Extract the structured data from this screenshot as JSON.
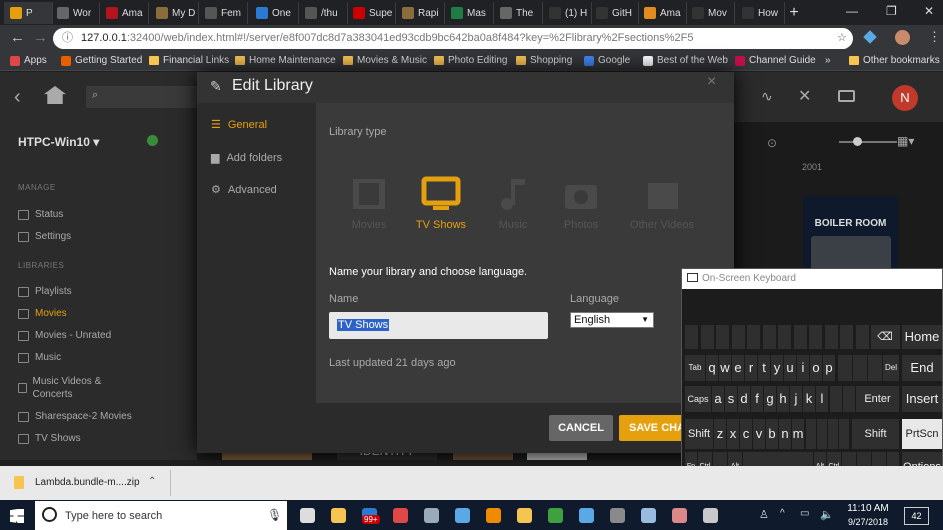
{
  "browser": {
    "tabs": [
      {
        "label": "P",
        "icon": "plex-icon",
        "color": "#e5a00d"
      },
      {
        "label": "Wor",
        "icon": "page-icon",
        "color": "#666"
      },
      {
        "label": "Ama",
        "icon": "adobe-icon",
        "color": "#b3141d"
      },
      {
        "label": "My D",
        "icon": "folder-icon",
        "color": "#8a6d3b"
      },
      {
        "label": "Fem",
        "icon": "wordpress-icon",
        "color": "#555"
      },
      {
        "label": "One",
        "icon": "diamond-icon",
        "color": "#2a7ad3"
      },
      {
        "label": "/thu",
        "icon": "google-icon",
        "color": "#555"
      },
      {
        "label": "Supe",
        "icon": "flag-icon",
        "color": "#c00"
      },
      {
        "label": "Rapi",
        "icon": "folder-icon",
        "color": "#8a6d3b"
      },
      {
        "label": "Mas",
        "icon": "sheet-icon",
        "color": "#1e7d44"
      },
      {
        "label": "The",
        "icon": "page-icon",
        "color": "#666"
      },
      {
        "label": "(1) H",
        "icon": "chevron-icon",
        "color": "#333"
      },
      {
        "label": "GitH",
        "icon": "github-icon",
        "color": "#333"
      },
      {
        "label": "Ama",
        "icon": "amazon-icon",
        "color": "#e48b1e"
      },
      {
        "label": "Mov",
        "icon": "chevron-icon",
        "color": "#333"
      },
      {
        "label": "How",
        "icon": "chevron-icon",
        "color": "#333"
      }
    ],
    "url": "127.0.0.1",
    "url_rest": ":32400/web/index.html#!/server/e8f007dc8d7a383041ed93cdb9bc642ba0a8f484?key=%2Flibrary%2Fsections%2F5",
    "bookmarks": [
      {
        "label": "Apps",
        "icon": "apps-icon"
      },
      {
        "label": "Getting Started",
        "icon": "firefox-icon"
      },
      {
        "label": "Financial Links",
        "icon": "folder-icon"
      },
      {
        "label": "Home Maintenance",
        "icon": "folder-icon"
      },
      {
        "label": "Movies & Music",
        "icon": "folder-icon"
      },
      {
        "label": "Photo Editing",
        "icon": "folder-icon"
      },
      {
        "label": "Shopping",
        "icon": "folder-icon"
      },
      {
        "label": "Google",
        "icon": "google-icon"
      },
      {
        "label": "Best of the Web",
        "icon": "m-icon"
      },
      {
        "label": "Channel Guide",
        "icon": "y-icon"
      }
    ],
    "more_bookmarks": "»",
    "other_bookmarks": "Other bookmarks"
  },
  "plex": {
    "server_name": "HTPC-Win10",
    "year_label": "2001",
    "poster_title": "BOILER ROOM",
    "identity_title": "IDENTITY",
    "user_initial": "N",
    "manage_header": "MANAGE",
    "libraries_header": "LIBRARIES",
    "sidebar_manage": [
      "Status",
      "Settings"
    ],
    "sidebar_libraries": [
      "Playlists",
      "Movies",
      "Movies - Unrated",
      "Music",
      "Music Videos & Concerts",
      "Sharespace-2 Movies",
      "TV Shows"
    ],
    "active_color": "#e5a00d"
  },
  "dialog": {
    "title": "Edit Library",
    "close": "×",
    "nav": [
      "General",
      "Add folders",
      "Advanced"
    ],
    "library_type_label": "Library type",
    "types": [
      "Movies",
      "TV Shows",
      "Music",
      "Photos",
      "Other Videos"
    ],
    "selected_type": "TV Shows",
    "section_title": "Name your library and choose language.",
    "name_label": "Name",
    "name_value": "TV Shows",
    "language_label": "Language",
    "language_value": "English",
    "last_updated": "Last updated 21 days ago",
    "cancel": "CANCEL",
    "save": "SAVE CHA"
  },
  "keyboard": {
    "title": "On-Screen Keyboard",
    "row1_letters": [
      "q",
      "w",
      "e",
      "r",
      "t",
      "y",
      "u",
      "i",
      "o",
      "p"
    ],
    "row2_letters": [
      "a",
      "s",
      "d",
      "f",
      "g",
      "h",
      "j",
      "k",
      "l"
    ],
    "row3_letters": [
      "z",
      "x",
      "c",
      "v",
      "b",
      "n",
      "m"
    ],
    "labels": {
      "tab": "Tab",
      "caps": "Caps",
      "shift": "Shift",
      "shift_right": "Shift",
      "enter": "Enter",
      "fn": "Fn",
      "ctrl": "Ctrl",
      "alt": "Alt",
      "alt_gr": "Alt",
      "ctrl_right": "Ctrl",
      "del": "Del",
      "backspace": "⌫",
      "home": "Home",
      "end": "End",
      "insert": "Insert",
      "prtscn": "PrtScn",
      "options": "Options"
    }
  },
  "downloads": {
    "file": "Lambda.bundle-m....zip"
  },
  "taskbar": {
    "search_placeholder": "Type here to search",
    "badge": "99+",
    "time": "11:10 AM",
    "date": "9/27/2018",
    "notification_count": "42"
  }
}
